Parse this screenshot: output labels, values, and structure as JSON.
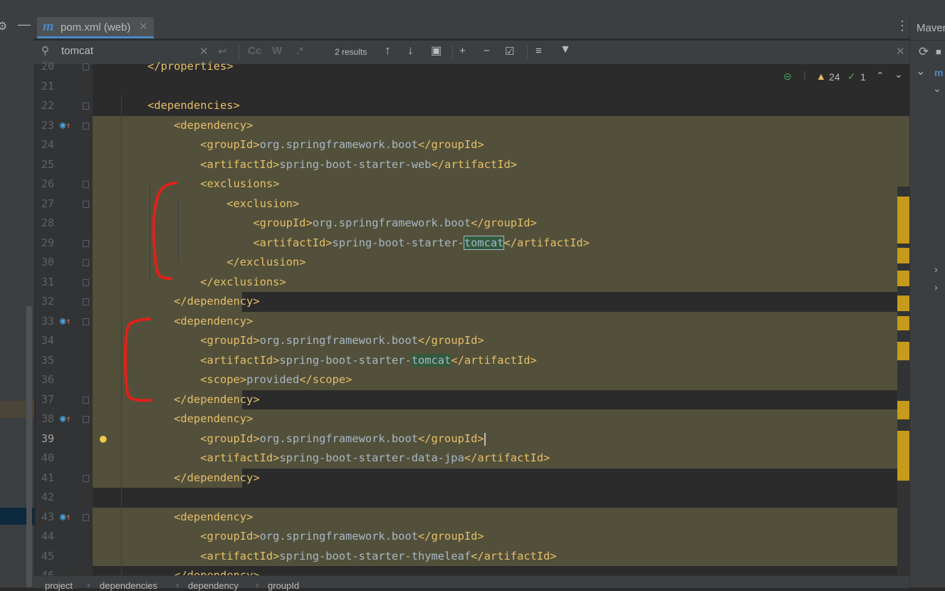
{
  "tab": {
    "name": "pom.xml (web)",
    "icon": "maven-m-icon"
  },
  "right_panel": {
    "title": "Maven"
  },
  "search": {
    "query": "tomcat",
    "results": "2 results",
    "case_label": "Cc",
    "word_label": "W",
    "regex_label": ".*"
  },
  "inspections": {
    "warnings": "24",
    "checks": "1"
  },
  "lines": [
    {
      "n": "20",
      "parts": [
        [
          "tag",
          "    </properties>"
        ]
      ]
    },
    {
      "n": "21",
      "parts": []
    },
    {
      "n": "22",
      "parts": [
        [
          "tag",
          "    <dependencies>"
        ]
      ]
    },
    {
      "n": "23",
      "parts": [
        [
          "tag",
          "        <dependency>"
        ]
      ]
    },
    {
      "n": "24",
      "parts": [
        [
          "tag",
          "            <groupId>"
        ],
        [
          "txt",
          "org.springframework.boot"
        ],
        [
          "tag",
          "</groupId>"
        ]
      ]
    },
    {
      "n": "25",
      "parts": [
        [
          "tag",
          "            <artifactId>"
        ],
        [
          "txt",
          "spring-boot-starter-web"
        ],
        [
          "tag",
          "</artifactId>"
        ]
      ]
    },
    {
      "n": "26",
      "parts": [
        [
          "tag",
          "            <exclusions>"
        ]
      ]
    },
    {
      "n": "27",
      "parts": [
        [
          "tag",
          "                <exclusion>"
        ]
      ]
    },
    {
      "n": "28",
      "parts": [
        [
          "tag",
          "                    <groupId>"
        ],
        [
          "txt",
          "org.springframework.boot"
        ],
        [
          "tag",
          "</groupId>"
        ]
      ]
    },
    {
      "n": "29",
      "parts": [
        [
          "tag",
          "                    <artifactId>"
        ],
        [
          "txt",
          "spring-boot-starter-"
        ],
        [
          "matchbox",
          "tomcat"
        ],
        [
          "tag",
          "</artifactId>"
        ]
      ]
    },
    {
      "n": "30",
      "parts": [
        [
          "tag",
          "                </exclusion>"
        ]
      ]
    },
    {
      "n": "31",
      "parts": [
        [
          "tag",
          "            </exclusions>"
        ]
      ]
    },
    {
      "n": "32",
      "parts": [
        [
          "tag",
          "        </dependency>"
        ]
      ]
    },
    {
      "n": "33",
      "parts": [
        [
          "tag",
          "        <dependency>"
        ]
      ]
    },
    {
      "n": "34",
      "parts": [
        [
          "tag",
          "            <groupId>"
        ],
        [
          "txt",
          "org.springframework.boot"
        ],
        [
          "tag",
          "</groupId>"
        ]
      ]
    },
    {
      "n": "35",
      "parts": [
        [
          "tag",
          "            <artifactId>"
        ],
        [
          "txt",
          "spring-boot-starter-"
        ],
        [
          "match",
          "tomcat"
        ],
        [
          "tag",
          "</artifactId>"
        ]
      ]
    },
    {
      "n": "36",
      "parts": [
        [
          "tag",
          "            <scope>"
        ],
        [
          "txt",
          "provided"
        ],
        [
          "tag",
          "</scope>"
        ]
      ]
    },
    {
      "n": "37",
      "parts": [
        [
          "tag",
          "        </dependency>"
        ]
      ]
    },
    {
      "n": "38",
      "parts": [
        [
          "tag",
          "        <dependency>"
        ]
      ]
    },
    {
      "n": "39",
      "parts": [
        [
          "tag",
          "            <groupId>"
        ],
        [
          "txt",
          "org.springframework.boot"
        ],
        [
          "tag",
          "</groupId>"
        ]
      ]
    },
    {
      "n": "40",
      "parts": [
        [
          "tag",
          "            <artifactId>"
        ],
        [
          "txt",
          "spring-boot-starter-data-jpa"
        ],
        [
          "tag",
          "</artifactId>"
        ]
      ]
    },
    {
      "n": "41",
      "parts": [
        [
          "tag",
          "        </dependency>"
        ]
      ]
    },
    {
      "n": "42",
      "parts": []
    },
    {
      "n": "43",
      "parts": [
        [
          "tag",
          "        <dependency>"
        ]
      ]
    },
    {
      "n": "44",
      "parts": [
        [
          "tag",
          "            <groupId>"
        ],
        [
          "txt",
          "org.springframework.boot"
        ],
        [
          "tag",
          "</groupId>"
        ]
      ]
    },
    {
      "n": "45",
      "parts": [
        [
          "tag",
          "            <artifactId>"
        ],
        [
          "txt",
          "spring-boot-starter-thymeleaf"
        ],
        [
          "tag",
          "</artifactId>"
        ]
      ]
    },
    {
      "n": "46",
      "parts": [
        [
          "tag",
          "        </dependency>"
        ]
      ]
    }
  ],
  "breadcrumb": [
    "project",
    "dependencies",
    "dependency",
    "groupId"
  ],
  "colors": {
    "highlight_band": "#52503a",
    "tag": "#e8bf6a",
    "annotation_red": "#e0201a",
    "marker": "#c69a1a"
  }
}
